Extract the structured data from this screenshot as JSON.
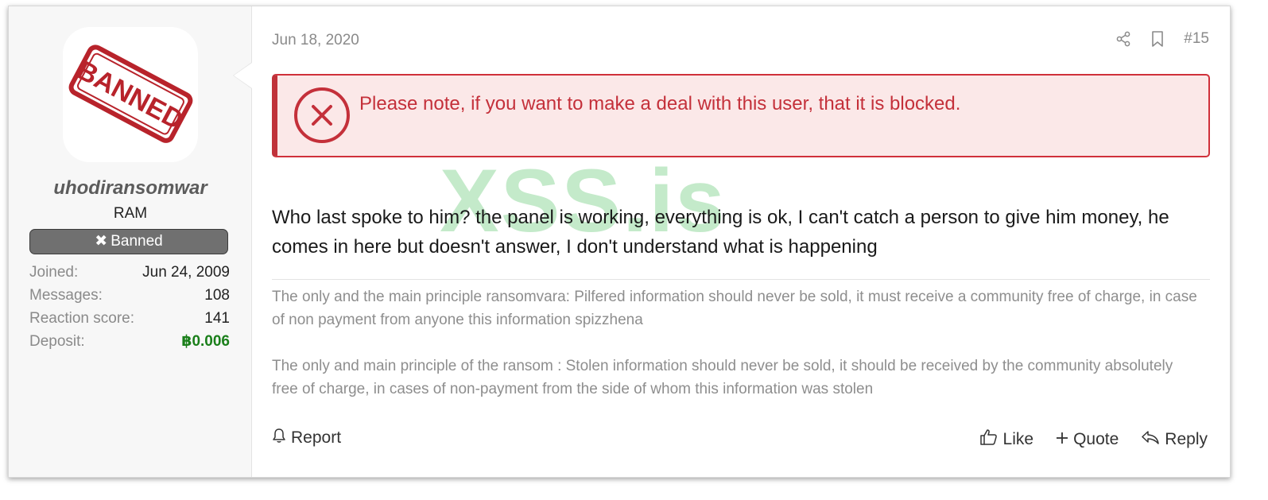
{
  "user": {
    "avatar_stamp_text": "BANNED",
    "username": "uhodiransomwar",
    "title": "RAM",
    "banner": "Banned",
    "stats": [
      {
        "label": "Joined:",
        "value": "Jun 24, 2009"
      },
      {
        "label": "Messages:",
        "value": "108"
      },
      {
        "label": "Reaction score:",
        "value": "141"
      },
      {
        "label": "Deposit:",
        "value": "฿0.006"
      }
    ]
  },
  "post": {
    "date": "Jun 18, 2020",
    "number": "#15",
    "notice": "Please note, if you want to make a deal with this user, that it is blocked.",
    "watermark": "XSS.is",
    "message": "Who last spoke to him? the panel is working, everything is ok, I can't catch a person to give him money, he comes in here but doesn't answer, I don't understand what is happening",
    "signature": [
      "The only and the main principle ransomvara: Pilfered information should never be sold, it must receive a community free of charge, in case of non payment from anyone this information spizzhena",
      "The only and main principle of the ransom : Stolen information should never be sold, it should be received by the community absolutely free of charge, in cases of non-payment from the side of whom this information was stolen"
    ]
  },
  "actions": {
    "report": "Report",
    "like": "Like",
    "quote": "Quote",
    "reply": "Reply"
  },
  "icons": {
    "share": "share-icon",
    "bookmark": "bookmark-icon",
    "notice": "error-circle-x-icon",
    "report": "bell-icon",
    "like": "thumbs-up-icon",
    "quote": "plus-icon",
    "reply": "reply-arrow-icon"
  },
  "colors": {
    "notice_text": "#c4303a",
    "notice_bg": "#fbe8e8",
    "deposit": "#1a7f1a",
    "banner_bg": "#707070",
    "watermark": "#46be5a"
  }
}
